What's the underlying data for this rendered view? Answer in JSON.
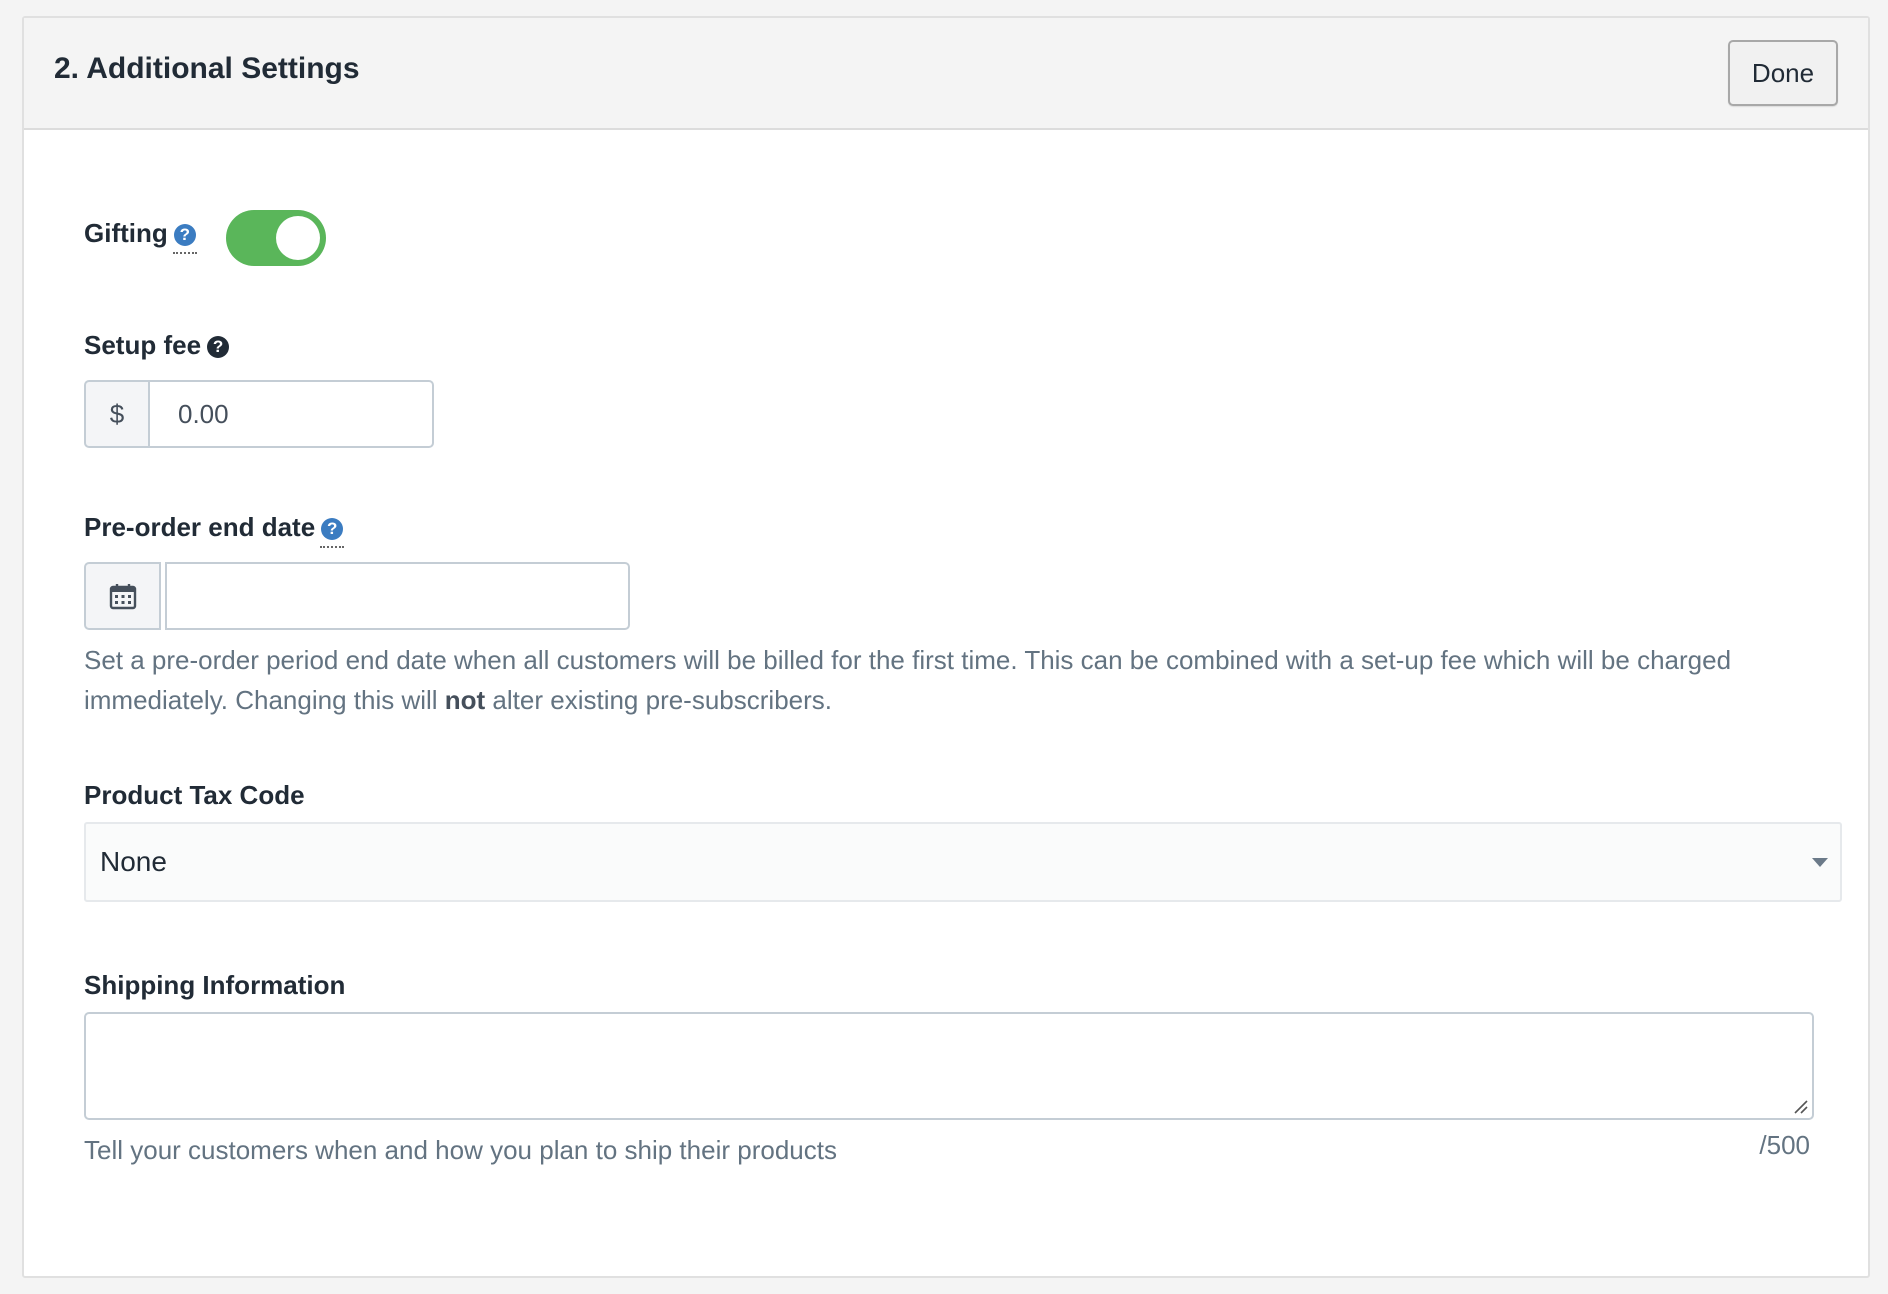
{
  "header": {
    "title": "2. Additional Settings",
    "done_label": "Done"
  },
  "gifting": {
    "label": "Gifting",
    "help_glyph": "?",
    "enabled": true,
    "toggle_color": "#5ab65a"
  },
  "setup_fee": {
    "label": "Setup fee",
    "help_glyph": "?",
    "currency_symbol": "$",
    "value": "0.00"
  },
  "preorder": {
    "label": "Pre-order end date",
    "help_glyph": "?",
    "value": "",
    "help_text_before": "Set a pre-order period end date when all customers will be billed for the first time. This can be combined with a set-up fee which will be charged immediately. Changing this will ",
    "help_text_bold": "not",
    "help_text_after": " alter existing pre-subscribers."
  },
  "tax_code": {
    "label": "Product Tax Code",
    "selected": "None"
  },
  "shipping": {
    "label": "Shipping Information",
    "value": "",
    "help_text": "Tell your customers when and how you plan to ship their products",
    "counter": "/500"
  }
}
